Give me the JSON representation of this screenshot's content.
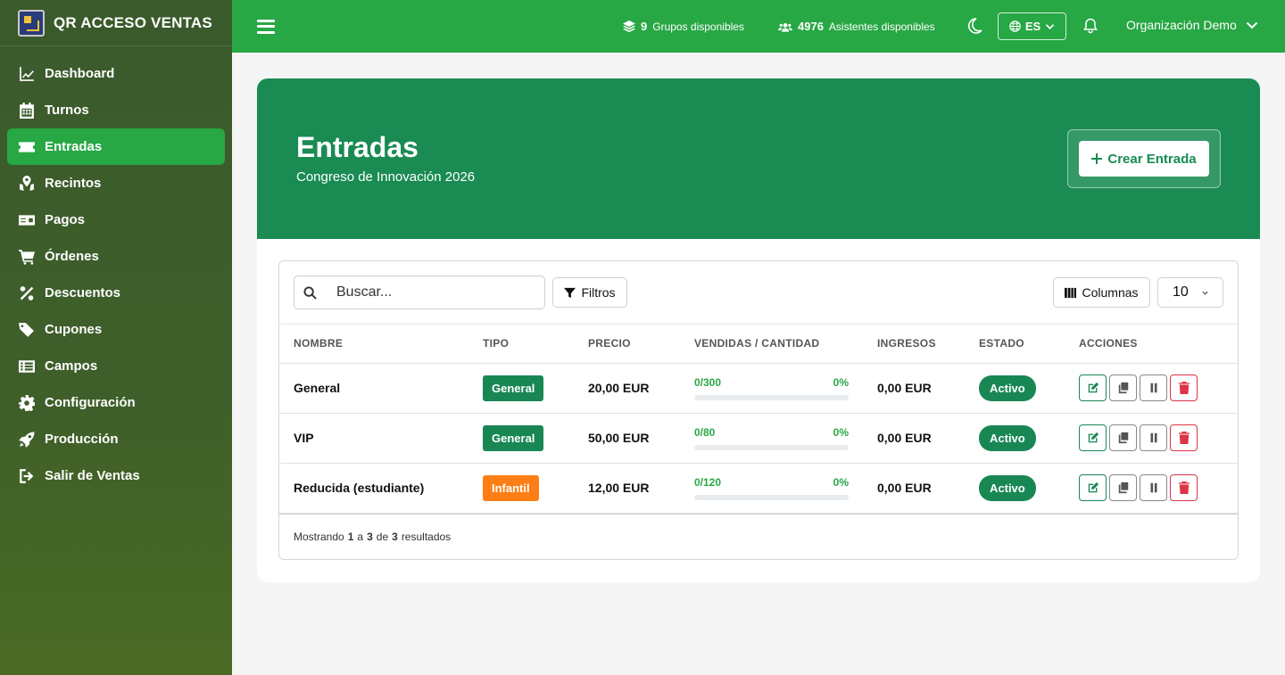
{
  "app": {
    "name": "QR ACCESO VENTAS"
  },
  "sidebar": {
    "items": [
      {
        "label": "Dashboard",
        "icon": "chart-line-icon",
        "active": false
      },
      {
        "label": "Turnos",
        "icon": "calendar-icon",
        "active": false
      },
      {
        "label": "Entradas",
        "icon": "ticket-icon",
        "active": true
      },
      {
        "label": "Recintos",
        "icon": "map-pin-icon",
        "active": false
      },
      {
        "label": "Pagos",
        "icon": "money-icon",
        "active": false
      },
      {
        "label": "Órdenes",
        "icon": "cart-icon",
        "active": false
      },
      {
        "label": "Descuentos",
        "icon": "percent-icon",
        "active": false
      },
      {
        "label": "Cupones",
        "icon": "tags-icon",
        "active": false
      },
      {
        "label": "Campos",
        "icon": "list-icon",
        "active": false
      },
      {
        "label": "Configuración",
        "icon": "gear-icon",
        "active": false
      },
      {
        "label": "Producción",
        "icon": "rocket-icon",
        "active": false
      },
      {
        "label": "Salir de Ventas",
        "icon": "sign-out-icon",
        "active": false
      }
    ]
  },
  "topbar": {
    "groups_count": "9",
    "groups_label": "Grupos disponibles",
    "attendees_count": "4976",
    "attendees_label": "Asistentes disponibles",
    "language": "ES",
    "organization": "Organización Demo"
  },
  "hero": {
    "title": "Entradas",
    "subtitle": "Congreso de Innovación 2026",
    "create_label": "Crear Entrada"
  },
  "toolbar": {
    "search_placeholder": "Buscar...",
    "filters_label": "Filtros",
    "columns_label": "Columnas",
    "per_page": "10"
  },
  "table": {
    "headers": [
      "NOMBRE",
      "TIPO",
      "PRECIO",
      "VENDIDAS / CANTIDAD",
      "INGRESOS",
      "ESTADO",
      "ACCIONES"
    ],
    "rows": [
      {
        "name": "General",
        "type": "General",
        "price": "20,00 EUR",
        "sold": "0/300",
        "percent": "0%",
        "progress": 0,
        "income": "0,00 EUR",
        "status": "Activo"
      },
      {
        "name": "VIP",
        "type": "General",
        "price": "50,00 EUR",
        "sold": "0/80",
        "percent": "0%",
        "progress": 0,
        "income": "0,00 EUR",
        "status": "Activo"
      },
      {
        "name": "Reducida (estudiante)",
        "type": "Infantil",
        "price": "12,00 EUR",
        "sold": "0/120",
        "percent": "0%",
        "progress": 0,
        "income": "0,00 EUR",
        "status": "Activo"
      }
    ]
  },
  "footer": {
    "prefix": "Mostrando",
    "from": "1",
    "to_word": "a",
    "to": "3",
    "of_word": "de",
    "total": "3",
    "suffix": "resultados"
  },
  "colors": {
    "topbar": "#28a745",
    "hero": "#198b53",
    "badge_general": "#198754",
    "badge_infantil": "#fd7e14",
    "danger": "#dc3545"
  }
}
